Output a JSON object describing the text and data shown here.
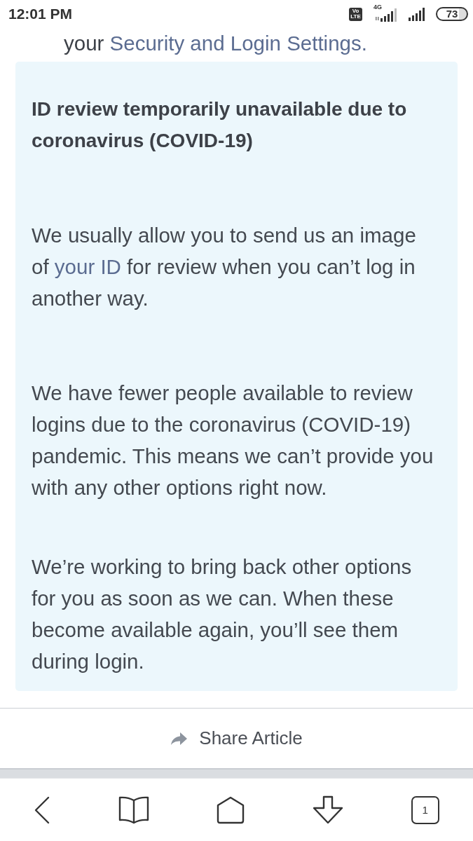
{
  "status_bar": {
    "time": "12:01 PM",
    "volte": "Vo LTE",
    "network": "4G",
    "battery": "73"
  },
  "top_line": [
    {
      "kind": "text",
      "text": "your "
    },
    {
      "kind": "link",
      "text": "Security and Login Settings."
    }
  ],
  "notice": {
    "title": "ID review temporarily unavailable due to coronavirus (COVID-19)",
    "paragraphs": [
      [
        {
          "kind": "text",
          "text": "We usually allow you to send us an image of "
        },
        {
          "kind": "link",
          "text": "your ID"
        },
        {
          "kind": "text",
          "text": " for review when you can’t log in another way."
        }
      ],
      [
        {
          "kind": "text",
          "text": "We have fewer people available to review logins due to the coronavirus (COVID-19) pandemic. This means we can’t provide you with any other options right now."
        }
      ],
      [
        {
          "kind": "text",
          "text": "We’re working to bring back other options for you as soon as we can. When these become available again, you’ll see them during login."
        }
      ]
    ]
  },
  "share": {
    "label": "Share Article"
  },
  "bottom_nav": [
    {
      "kind": "back"
    },
    {
      "kind": "book"
    },
    {
      "kind": "home"
    },
    {
      "kind": "download"
    },
    {
      "kind": "tabs",
      "count": "1"
    }
  ]
}
